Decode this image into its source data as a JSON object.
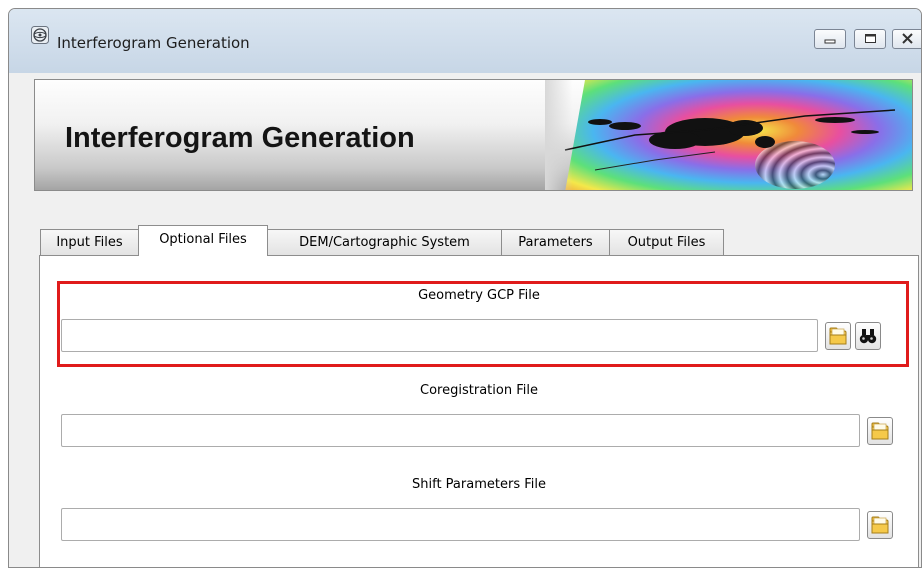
{
  "window": {
    "title": "Interferogram Generation"
  },
  "banner": {
    "title": "Interferogram Generation"
  },
  "tabs": [
    {
      "label": "Input Files"
    },
    {
      "label": "Optional Files",
      "selected": true
    },
    {
      "label": "DEM/Cartographic System"
    },
    {
      "label": "Parameters"
    },
    {
      "label": "Output Files"
    }
  ],
  "sections": {
    "geometry_gcp": {
      "label": "Geometry GCP File",
      "value": ""
    },
    "coregistration": {
      "label": "Coregistration File",
      "value": ""
    },
    "shift_parameters": {
      "label": "Shift Parameters File",
      "value": ""
    }
  },
  "colors": {
    "highlight": "#e01b1b"
  },
  "icons": [
    "app-icon",
    "minimize-icon",
    "maximize-icon",
    "close-icon",
    "folder-icon",
    "binoculars-icon"
  ]
}
